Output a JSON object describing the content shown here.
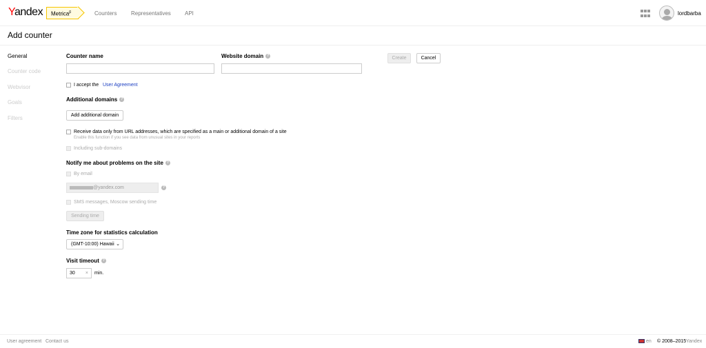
{
  "header": {
    "logo_y": "Y",
    "logo_rest": "andex",
    "product": "Metrica",
    "product_sup": "β",
    "nav": [
      "Counters",
      "Representatives",
      "API"
    ],
    "username": "lordbarba"
  },
  "page_title": "Add counter",
  "sidebar": {
    "items": [
      {
        "label": "General",
        "active": true
      },
      {
        "label": "Counter code",
        "active": false
      },
      {
        "label": "Webvisor",
        "active": false
      },
      {
        "label": "Goals",
        "active": false
      },
      {
        "label": "Filters",
        "active": false
      }
    ]
  },
  "form": {
    "counter_name_label": "Counter name",
    "counter_name_value": "",
    "website_domain_label": "Website domain",
    "website_domain_value": "",
    "create_label": "Create",
    "cancel_label": "Cancel",
    "agreement_prefix": "I accept the",
    "agreement_link": "User Agreement",
    "additional_domains_label": "Additional domains",
    "add_domain_button": "Add additional domain",
    "receive_data_label": "Receive data only from URL addresses, which are specified as a main or additional domain of a site",
    "receive_data_hint": "Enable this function if you see data from unusual sites in your reports",
    "subdomains_label": "Including sub-domains",
    "notify_label": "Notify me about problems on the site",
    "by_email_label": "By email",
    "email_value": "@yandex.com",
    "sms_label": "SMS messages, Moscow sending time",
    "sending_time_button": "Sending time",
    "timezone_label": "Time zone for statistics calculation",
    "timezone_value": "(GMT-10:00) Hawaii",
    "visit_timeout_label": "Visit timeout",
    "visit_timeout_value": "30",
    "visit_timeout_unit": "min."
  },
  "footer": {
    "links": [
      "User agreement",
      "Contact us"
    ],
    "lang": "en",
    "copyright": "© 2008–2015",
    "brand": "Yandex"
  },
  "colors": {
    "accent": "#f6c500",
    "link": "#1a3dc1",
    "brand_red": "#ff0000"
  }
}
